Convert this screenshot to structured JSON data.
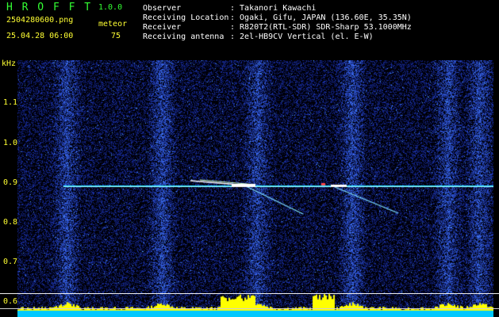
{
  "header": {
    "title": "H R O F F T",
    "version": "1.0.0",
    "filename": "2504280600.png",
    "mode_label": "meteor",
    "datetime": "25.04.28 06:00",
    "count": "75",
    "info_labels": [
      "Observer",
      "Receiving Location",
      "Receiver",
      "Receiving antenna"
    ],
    "info_values": [
      ": Takanori Kawachi",
      ": Ogaki, Gifu, JAPAN (136.60E, 35.35N)",
      ": R820T2(RTL-SDR) SDR-Sharp 53.1000MHz",
      ": 2el-HB9CV Vertical (el. E-W)"
    ]
  },
  "axis": {
    "unit": "kHz",
    "y_ticks": [
      "1.1",
      "1.0",
      "0.9",
      "0.8",
      "0.7",
      "0.6"
    ],
    "x_ticks": [
      "0601",
      "0602",
      "0603",
      "0604",
      "0605",
      "0606",
      "0607",
      "0608",
      "0609",
      "0610"
    ]
  },
  "colors": {
    "background": "#000000",
    "noise": "#1a2fbf",
    "carrier": "#22e0ff",
    "meteor": "#ffffff",
    "histogram": "#ffff00",
    "baseline": "#00c8ff"
  }
}
